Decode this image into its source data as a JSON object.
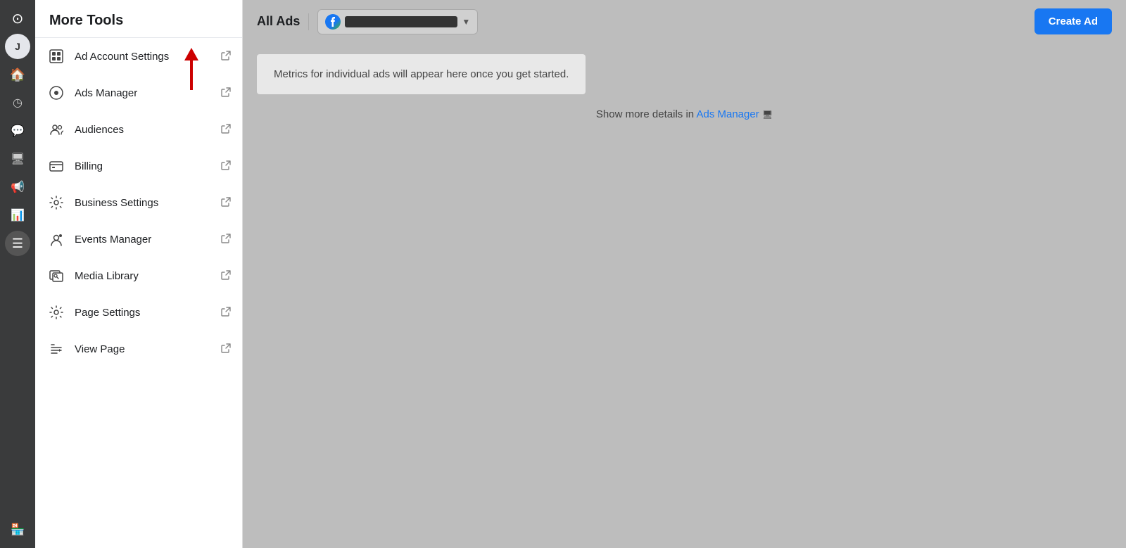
{
  "iconNav": {
    "items": [
      {
        "name": "logo-icon",
        "symbol": "⊙",
        "active": false
      },
      {
        "name": "avatar-icon",
        "symbol": "J",
        "active": false,
        "isAvatar": true
      },
      {
        "name": "home-icon",
        "symbol": "⌂",
        "active": false
      },
      {
        "name": "recent-icon",
        "symbol": "◷",
        "active": false
      },
      {
        "name": "chat-icon",
        "symbol": "💬",
        "active": false
      },
      {
        "name": "pages-icon",
        "symbol": "🖥",
        "active": false
      },
      {
        "name": "megaphone-icon",
        "symbol": "📢",
        "active": false
      },
      {
        "name": "stats-icon",
        "symbol": "📊",
        "active": false
      },
      {
        "name": "menu-icon",
        "symbol": "☰",
        "active": true
      },
      {
        "name": "marketplace-icon",
        "symbol": "🏪",
        "active": false,
        "bottom": true
      }
    ]
  },
  "moreTools": {
    "header": "More Tools",
    "items": [
      {
        "id": "ad-account-settings",
        "label": "Ad Account Settings",
        "icon": "⊞"
      },
      {
        "id": "ads-manager",
        "label": "Ads Manager",
        "icon": "⊙"
      },
      {
        "id": "audiences",
        "label": "Audiences",
        "icon": "👥"
      },
      {
        "id": "billing",
        "label": "Billing",
        "icon": "🧾"
      },
      {
        "id": "business-settings",
        "label": "Business Settings",
        "icon": "⚙"
      },
      {
        "id": "events-manager",
        "label": "Events Manager",
        "icon": "👤"
      },
      {
        "id": "media-library",
        "label": "Media Library",
        "icon": "🖼"
      },
      {
        "id": "page-settings",
        "label": "Page Settings",
        "icon": "⚙"
      },
      {
        "id": "view-page",
        "label": "View Page",
        "icon": "⚑"
      }
    ],
    "externalLinkSymbol": "↗"
  },
  "topBar": {
    "allAdsLabel": "All Ads",
    "createAdButton": "Create Ad"
  },
  "mainContent": {
    "metricsMessage": "Metrics for individual ads will appear here once you get started.",
    "showMorePrefix": "Show more details in ",
    "adsManagerLinkText": "Ads Manager"
  }
}
